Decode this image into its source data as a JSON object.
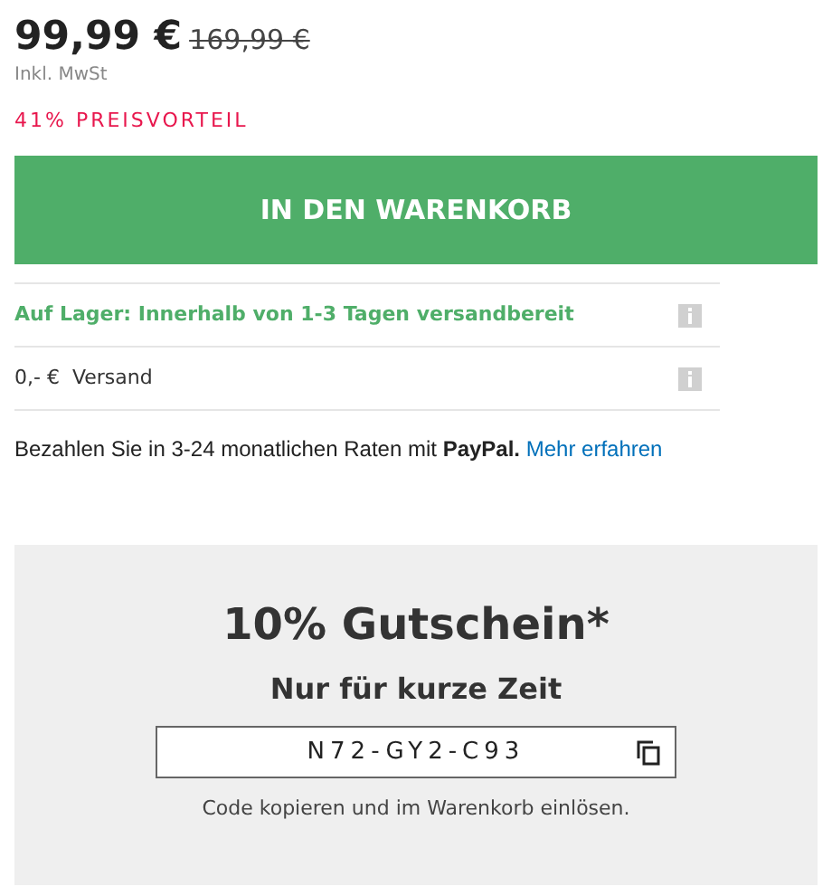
{
  "price": {
    "current": "99,99 €",
    "old": "169,99 €",
    "tax_note": "Inkl. MwSt",
    "discount": "41% PREISVORTEIL"
  },
  "cart_button": "IN DEN WARENKORB",
  "info_rows": [
    {
      "kind": "stock",
      "text": "Auf Lager: Innerhalb von 1-3 Tagen versandbereit"
    },
    {
      "kind": "shipping",
      "text": "0,- €  Versand"
    }
  ],
  "paypal": {
    "text": "Bezahlen Sie in 3-24 monatlichen Raten mit **PayPal.**",
    "link": "Mehr erfahren"
  },
  "voucher": {
    "title": "10% Gutschein*",
    "subtitle": "Nur für kurze Zeit",
    "code": "N72-GY2-C93",
    "note": "Code kopieren und im Warenkorb einlösen."
  }
}
